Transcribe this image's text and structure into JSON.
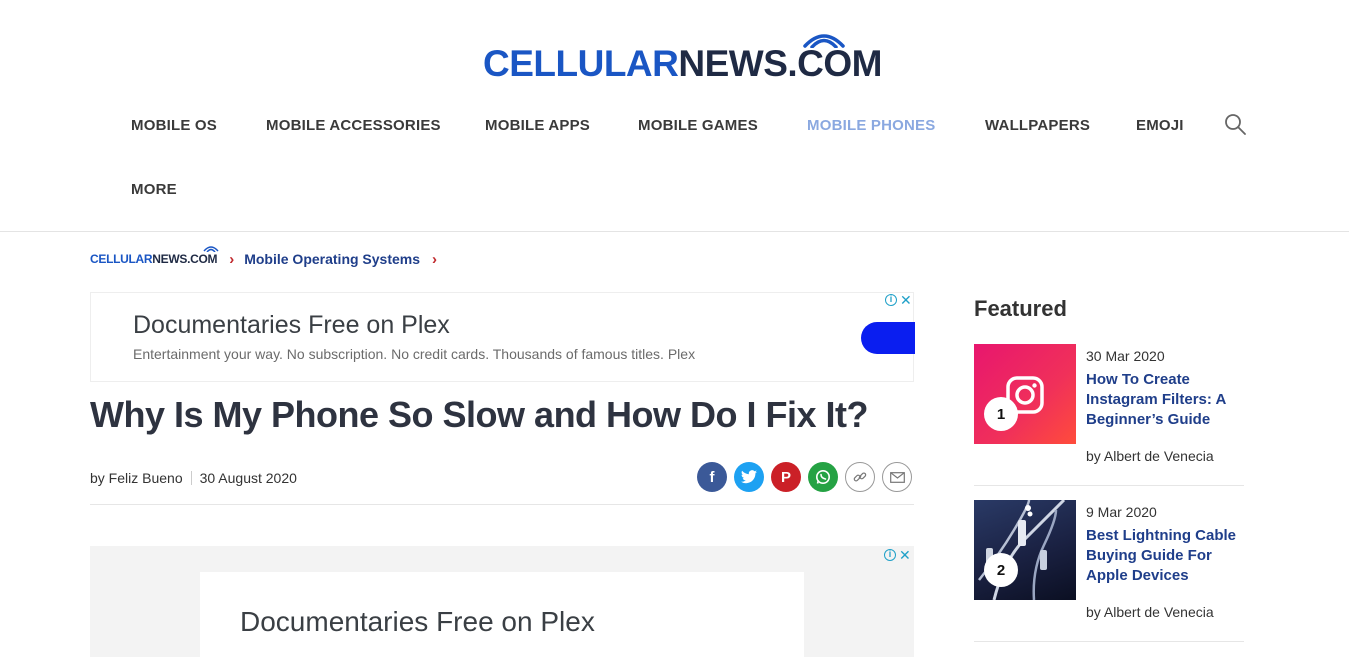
{
  "brand": {
    "logo_part1": "CELLULAR",
    "logo_part2": "NEWS.COM",
    "color_primary": "#1a56c4",
    "color_dark": "#1f2a44"
  },
  "nav": {
    "items": [
      {
        "label": "MOBILE OS"
      },
      {
        "label": "MOBILE ACCESSORIES"
      },
      {
        "label": "MOBILE APPS"
      },
      {
        "label": "MOBILE GAMES"
      },
      {
        "label": "MOBILE PHONES",
        "active": true
      },
      {
        "label": "WALLPAPERS"
      },
      {
        "label": "EMOJI"
      },
      {
        "label": "MORE"
      }
    ],
    "search_icon": "search-icon",
    "active_color": "#8aa8e0"
  },
  "breadcrumb": {
    "home_part1": "CELLULAR",
    "home_part2": "NEWS.COM",
    "sep": "›",
    "section": "Mobile Operating Systems"
  },
  "ad_top": {
    "title": "Documentaries Free on Plex",
    "subtitle": "Entertainment your way. No subscription. No credit cards. Thousands of famous titles. Plex",
    "cta_color": "#0a1ef0"
  },
  "article": {
    "title": "Why Is My Phone So Slow and How Do I Fix It?",
    "author": "by Feliz Bueno",
    "date": "30 August 2020",
    "share": [
      "facebook-icon",
      "twitter-icon",
      "pinterest-icon",
      "whatsapp-icon",
      "link-icon",
      "email-icon"
    ]
  },
  "ad_bottom": {
    "title": "Documentaries Free on Plex"
  },
  "sidebar": {
    "heading": "Featured",
    "cards": [
      {
        "rank": "1",
        "date": "30 Mar 2020",
        "title": "How To Create Instagram Filters: A Beginner’s Guide",
        "author": "by Albert de Venecia"
      },
      {
        "rank": "2",
        "date": "9 Mar 2020",
        "title": "Best Lightning Cable Buying Guide For Apple Devices",
        "author": "by Albert de Venecia"
      }
    ]
  }
}
